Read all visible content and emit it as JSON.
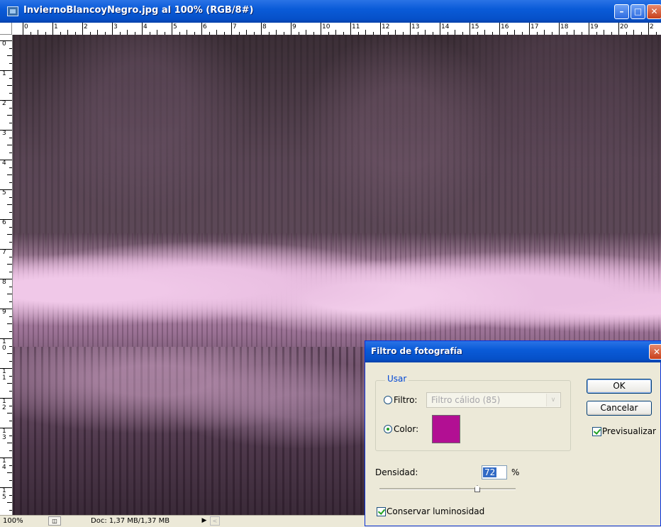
{
  "window": {
    "title": "InviernoBlancoyNegro.jpg al 100% (RGB/8#)",
    "minimize_glyph": "–",
    "maximize_glyph": "□",
    "close_glyph": "✕"
  },
  "rulers": {
    "top": [
      "0",
      "1",
      "2",
      "3",
      "4",
      "5",
      "6",
      "7",
      "8",
      "9",
      "10",
      "11",
      "12",
      "13",
      "14",
      "15",
      "16",
      "17",
      "18",
      "19",
      "20",
      "2"
    ],
    "left": [
      "0",
      "1",
      "2",
      "3",
      "4",
      "5",
      "6",
      "7",
      "8",
      "9",
      "1\n0",
      "1\n1",
      "1\n2",
      "1\n3",
      "1\n4",
      "1\n5"
    ]
  },
  "statusbar": {
    "zoom": "100%",
    "doc_size": "Doc: 1,37 MB/1,37 MB",
    "arrow_glyph": "▶",
    "scroll_glyph": "<"
  },
  "dialog": {
    "title": "Filtro de fotografía",
    "close_glyph": "✕",
    "group_label": "Usar",
    "filter_label": "Filtro:",
    "filter_value": "Filtro cálido (85)",
    "filter_arrow": "∨",
    "color_label": "Color:",
    "color_swatch": "#b20f93",
    "selected_option": "color",
    "ok_label": "OK",
    "cancel_label": "Cancelar",
    "preview_label": "Previsualizar",
    "preview_checked": true,
    "density_label": "Densidad:",
    "density_value": "72",
    "density_unit": "%",
    "density_percent": 72,
    "luminosity_label": "Conservar luminosidad",
    "luminosity_checked": true
  }
}
